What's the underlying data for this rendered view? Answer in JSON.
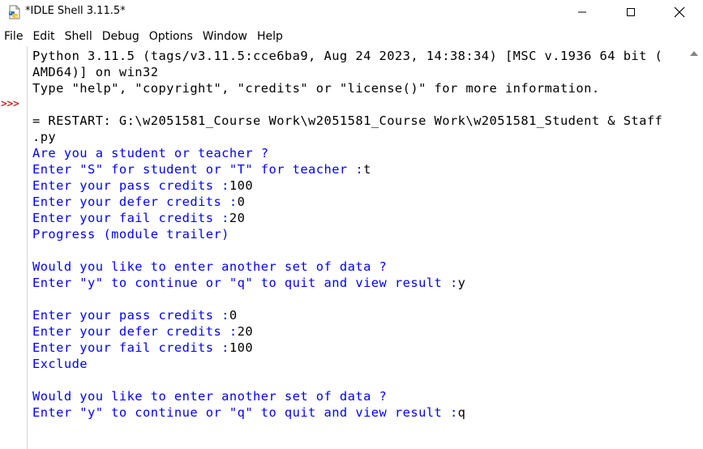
{
  "window": {
    "title": "*IDLE Shell 3.11.5*"
  },
  "menu": [
    {
      "label": "File"
    },
    {
      "label": "Edit"
    },
    {
      "label": "Shell"
    },
    {
      "label": "Debug"
    },
    {
      "label": "Options"
    },
    {
      "label": "Window"
    },
    {
      "label": "Help"
    }
  ],
  "prompt": ">>>",
  "shell_lines": [
    {
      "style": "std",
      "text": "Python 3.11.5 (tags/v3.11.5:cce6ba9, Aug 24 2023, 14:38:34) [MSC v.1936 64 bit ("
    },
    {
      "style": "std",
      "text": "AMD64)] on win32"
    },
    {
      "style": "std",
      "text": "Type \"help\", \"copyright\", \"credits\" or \"license()\" for more information."
    },
    {
      "style": "std",
      "text": ""
    },
    {
      "style": "std",
      "text": "= RESTART: G:\\w2051581_Course Work\\w2051581_Course Work\\w2051581_Student & Staff"
    },
    {
      "style": "std",
      "text": ".py"
    },
    {
      "style": "out",
      "text": "Are you a student or teacher ?"
    },
    {
      "style": "out",
      "text": "Enter \"S\" for student or \"T\" for teacher :",
      "input": "t"
    },
    {
      "style": "out",
      "text": "Enter your pass credits :",
      "input": "100"
    },
    {
      "style": "out",
      "text": "Enter your defer credits :",
      "input": "0"
    },
    {
      "style": "out",
      "text": "Enter your fail credits :",
      "input": "20"
    },
    {
      "style": "out",
      "text": "Progress (module trailer)"
    },
    {
      "style": "out",
      "text": ""
    },
    {
      "style": "out",
      "text": "Would you like to enter another set of data ?"
    },
    {
      "style": "out",
      "text": "Enter \"y\" to continue or \"q\" to quit and view result :",
      "input": "y"
    },
    {
      "style": "out",
      "text": ""
    },
    {
      "style": "out",
      "text": "Enter your pass credits :",
      "input": "0"
    },
    {
      "style": "out",
      "text": "Enter your defer credits :",
      "input": "20"
    },
    {
      "style": "out",
      "text": "Enter your fail credits :",
      "input": "100"
    },
    {
      "style": "out",
      "text": "Exclude"
    },
    {
      "style": "out",
      "text": ""
    },
    {
      "style": "out",
      "text": "Would you like to enter another set of data ?"
    },
    {
      "style": "out",
      "text": "Enter \"y\" to continue or \"q\" to quit and view result :",
      "input": "q"
    }
  ],
  "colors": {
    "output": "#0000ff",
    "standard": "#000000",
    "prompt": "#c30000"
  },
  "icons": {
    "app": "idle-python-icon",
    "minimize": "minimize-icon",
    "maximize": "maximize-icon",
    "close": "close-icon",
    "scroll_up": "scroll-up-arrow-icon"
  }
}
